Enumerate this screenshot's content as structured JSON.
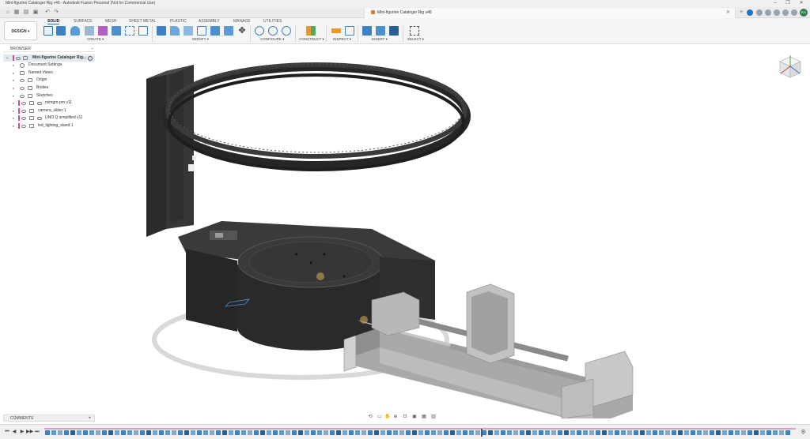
{
  "window": {
    "title": "Mini-figurine Cataloger Rig v46 - Autodesk Fusion Personal (Not for Commercial Use)",
    "controls": [
      "–",
      "❐",
      "✕"
    ]
  },
  "document_tab": {
    "label": "Mini-figurine Cataloger Rig v46",
    "close": "✕"
  },
  "user": {
    "initials": "KA"
  },
  "toolbar": {
    "workspace": "DESIGN ▾",
    "tabs": [
      "SOLID",
      "SURFACE",
      "MESH",
      "SHEET METAL",
      "PLASTIC",
      "ASSEMBLY",
      "MANAGE",
      "UTILITIES"
    ],
    "active_tab": "SOLID",
    "groups": [
      "CREATE ▾",
      "MODIFY ▾",
      "CONFIGURE ▾",
      "CONSTRUCT ▾",
      "INSPECT ▾",
      "INSERT ▾",
      "SELECT ▾"
    ]
  },
  "browser": {
    "title": "BROWSER",
    "collapse": "–",
    "items": [
      {
        "label": "Mini-figurine Cataloger Rig...",
        "kind": "root"
      },
      {
        "label": "Document Settings",
        "kind": "settings"
      },
      {
        "label": "Named Views",
        "kind": "folder"
      },
      {
        "label": "Origin",
        "kind": "folder"
      },
      {
        "label": "Bodies",
        "kind": "folder"
      },
      {
        "label": "Sketches",
        "kind": "folder"
      },
      {
        "label": "mimgm-pm v11",
        "kind": "component"
      },
      {
        "label": "camera_slider:1",
        "kind": "component"
      },
      {
        "label": "UNO Q simplified v11",
        "kind": "component"
      },
      {
        "label": "led_lighting_stand:1",
        "kind": "component"
      }
    ]
  },
  "comments": {
    "label": "COMMENTS",
    "add": "+"
  },
  "timeline": {
    "controls": [
      "⏮",
      "◀",
      "▶",
      "▶▶",
      "⏭"
    ],
    "settings": "⚙"
  },
  "colors": {
    "accent": "#1f74bf",
    "model_dark": "#2e2e2e",
    "model_light": "#bdbdbd",
    "timeline_marker": "#cc4aa2"
  }
}
